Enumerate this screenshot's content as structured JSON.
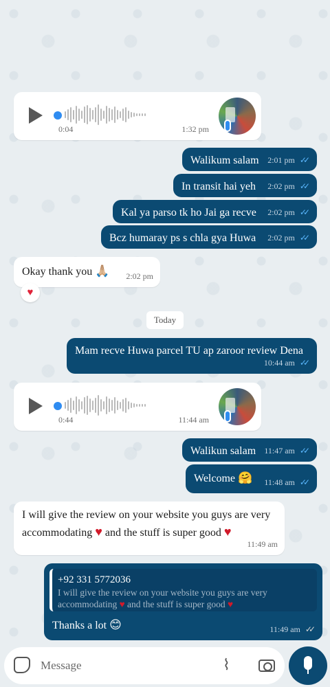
{
  "messages": {
    "voice1": {
      "duration": "0:04",
      "time": "1:32 pm"
    },
    "m1": {
      "text": "Walikum salam",
      "time": "2:01 pm"
    },
    "m2": {
      "text": "In transit hai yeh",
      "time": "2:02 pm"
    },
    "m3": {
      "text": "Kal ya parso tk ho Jai ga recve",
      "time": "2:02 pm"
    },
    "m4": {
      "text": "Bcz humaray ps s chla gya Huwa",
      "time": "2:02 pm"
    },
    "m5": {
      "text": "Okay thank you",
      "emoji": "🙏🏼",
      "time": "2:02 pm",
      "reaction": "♥"
    },
    "date_divider": "Today",
    "m6": {
      "text": "Mam recve Huwa parcel TU ap zaroor review Dena",
      "time": "10:44 am"
    },
    "voice2": {
      "duration": "0:44",
      "time": "11:44 am"
    },
    "m7": {
      "text": "Walikun salam",
      "time": "11:47 am"
    },
    "m8": {
      "text": "Welcome",
      "emoji": "🤗",
      "time": "11:48 am"
    },
    "m9": {
      "line1": "I will give the review on your website you guys are very",
      "line2_a": "accommodating",
      "line2_b": "and the stuff is super good",
      "heart": "♥",
      "time": "11:49 am"
    },
    "m10": {
      "quote_author": "+92 331 5772036",
      "quote_line1": "I will give the review on your website you guys are very",
      "quote_line2_a": "accommodating",
      "quote_line2_b": "and the stuff is super good",
      "text": "Thanks a lot",
      "emoji": "😊",
      "time": "11:49 am"
    }
  },
  "composer": {
    "placeholder": "Message"
  },
  "ticks": "✓✓",
  "colors": {
    "outgoing": "#0b4a72",
    "incoming": "#ffffff",
    "read_tick": "#5cb8ff",
    "heart": "#d11a2a"
  }
}
